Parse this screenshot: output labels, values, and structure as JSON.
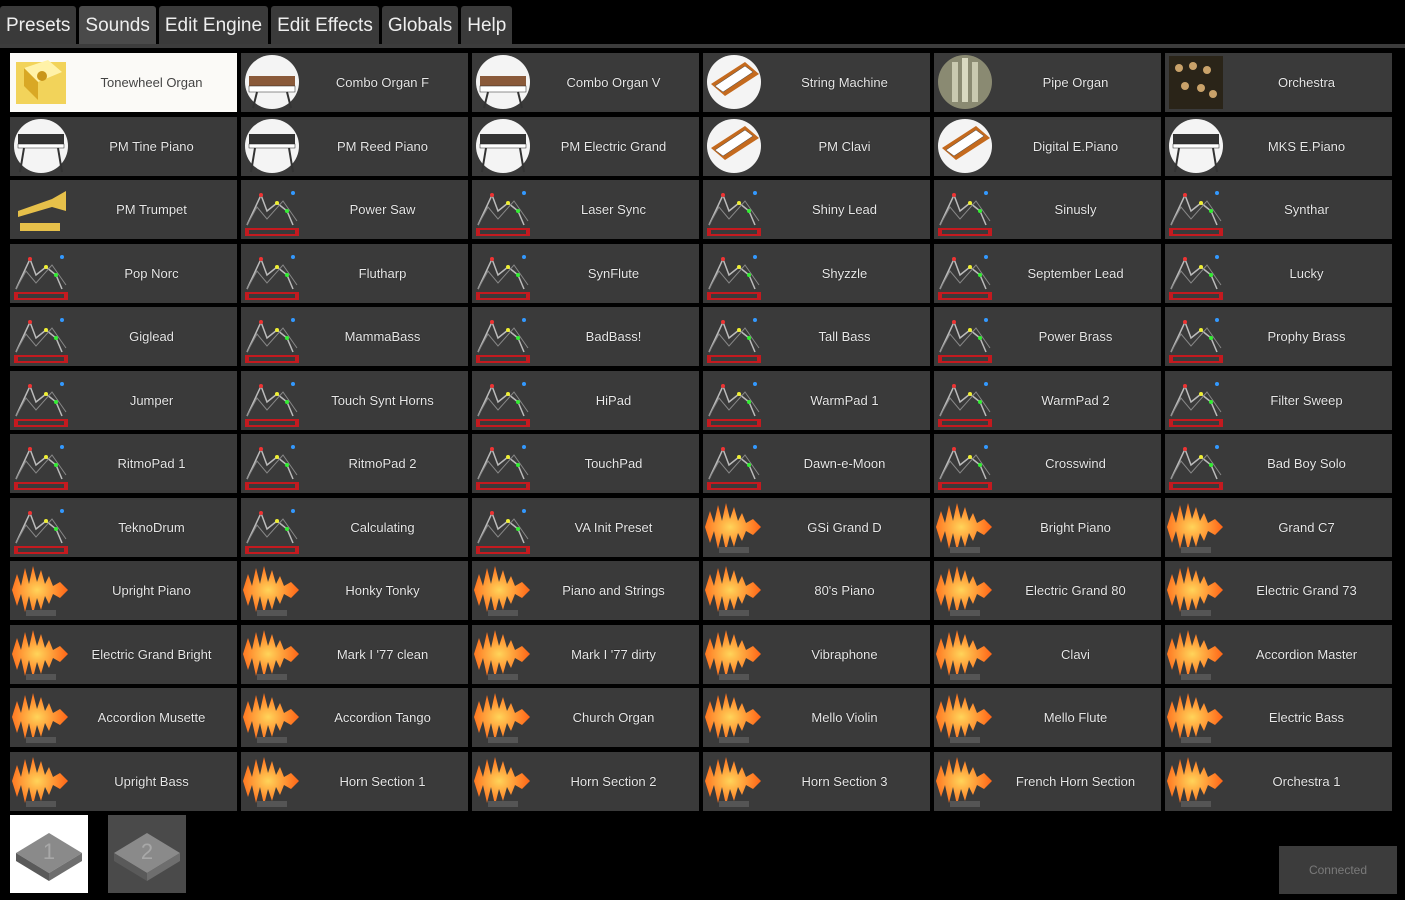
{
  "tabs": [
    {
      "label": "Presets"
    },
    {
      "label": "Sounds"
    },
    {
      "label": "Edit Engine"
    },
    {
      "label": "Edit Effects"
    },
    {
      "label": "Globals"
    },
    {
      "label": "Help"
    }
  ],
  "active_tab": 1,
  "colors": {
    "cell_bg": "#3a3a3a",
    "selected_bg": "#fbfaf7",
    "tab_bg": "#3a3a3a",
    "background": "#000000",
    "sample_icon": "#ff7a1a",
    "synth_icon_text": "#e21e24"
  },
  "sounds": [
    {
      "name": "Tonewheel Organ",
      "icon": "tonewheel-icon",
      "selected": true
    },
    {
      "name": "Combo Organ F",
      "icon": "organ-icon"
    },
    {
      "name": "Combo Organ V",
      "icon": "organ-icon"
    },
    {
      "name": "String Machine",
      "icon": "keyboard-icon"
    },
    {
      "name": "Pipe Organ",
      "icon": "pipe-organ-icon"
    },
    {
      "name": "Orchestra",
      "icon": "orchestra-icon"
    },
    {
      "name": "PM Tine Piano",
      "icon": "keyboard-stand-icon"
    },
    {
      "name": "PM Reed Piano",
      "icon": "keyboard-stand-icon"
    },
    {
      "name": "PM Electric Grand",
      "icon": "keyboard-stand-icon"
    },
    {
      "name": "PM Clavi",
      "icon": "keyboard-icon"
    },
    {
      "name": "Digital E.Piano",
      "icon": "keyboard-icon"
    },
    {
      "name": "MKS E.Piano",
      "icon": "keyboard-stand-icon"
    },
    {
      "name": "PM Trumpet",
      "icon": "trumpet-icon"
    },
    {
      "name": "Power Saw",
      "icon": "synth-envelope-icon"
    },
    {
      "name": "Laser Sync",
      "icon": "synth-envelope-icon"
    },
    {
      "name": "Shiny Lead",
      "icon": "synth-envelope-icon"
    },
    {
      "name": "Sinusly",
      "icon": "synth-envelope-icon"
    },
    {
      "name": "Synthar",
      "icon": "synth-envelope-icon"
    },
    {
      "name": "Pop Norc",
      "icon": "synth-envelope-icon"
    },
    {
      "name": "Flutharp",
      "icon": "synth-envelope-icon"
    },
    {
      "name": "SynFlute",
      "icon": "synth-envelope-icon"
    },
    {
      "name": "Shyzzle",
      "icon": "synth-envelope-icon"
    },
    {
      "name": "September Lead",
      "icon": "synth-envelope-icon"
    },
    {
      "name": "Lucky",
      "icon": "synth-envelope-icon"
    },
    {
      "name": "Giglead",
      "icon": "synth-envelope-icon"
    },
    {
      "name": "MammaBass",
      "icon": "synth-envelope-icon"
    },
    {
      "name": "BadBass!",
      "icon": "synth-envelope-icon"
    },
    {
      "name": "Tall Bass",
      "icon": "synth-envelope-icon"
    },
    {
      "name": "Power Brass",
      "icon": "synth-envelope-icon"
    },
    {
      "name": "Prophy Brass",
      "icon": "synth-envelope-icon"
    },
    {
      "name": "Jumper",
      "icon": "synth-envelope-icon"
    },
    {
      "name": "Touch Synt Horns",
      "icon": "synth-envelope-icon"
    },
    {
      "name": "HiPad",
      "icon": "synth-envelope-icon"
    },
    {
      "name": "WarmPad 1",
      "icon": "synth-envelope-icon"
    },
    {
      "name": "WarmPad 2",
      "icon": "synth-envelope-icon"
    },
    {
      "name": "Filter Sweep",
      "icon": "synth-envelope-icon"
    },
    {
      "name": "RitmoPad 1",
      "icon": "synth-envelope-icon"
    },
    {
      "name": "RitmoPad 2",
      "icon": "synth-envelope-icon"
    },
    {
      "name": "TouchPad",
      "icon": "synth-envelope-icon"
    },
    {
      "name": "Dawn-e-Moon",
      "icon": "synth-envelope-icon"
    },
    {
      "name": "Crosswind",
      "icon": "synth-envelope-icon"
    },
    {
      "name": "Bad Boy Solo",
      "icon": "synth-envelope-icon"
    },
    {
      "name": "TeknoDrum",
      "icon": "synth-envelope-icon"
    },
    {
      "name": "Calculating",
      "icon": "synth-envelope-icon"
    },
    {
      "name": "VA Init Preset",
      "icon": "synth-envelope-icon"
    },
    {
      "name": "GSi Grand D",
      "icon": "sample-waveform-icon"
    },
    {
      "name": "Bright Piano",
      "icon": "sample-waveform-icon"
    },
    {
      "name": "Grand C7",
      "icon": "sample-waveform-icon"
    },
    {
      "name": "Upright Piano",
      "icon": "sample-waveform-icon"
    },
    {
      "name": "Honky Tonky",
      "icon": "sample-waveform-icon"
    },
    {
      "name": "Piano and Strings",
      "icon": "sample-waveform-icon"
    },
    {
      "name": "80's Piano",
      "icon": "sample-waveform-icon"
    },
    {
      "name": "Electric Grand 80",
      "icon": "sample-waveform-icon"
    },
    {
      "name": "Electric Grand 73",
      "icon": "sample-waveform-icon"
    },
    {
      "name": "Electric Grand Bright",
      "icon": "sample-waveform-icon"
    },
    {
      "name": "Mark I '77 clean",
      "icon": "sample-waveform-icon"
    },
    {
      "name": "Mark I '77 dirty",
      "icon": "sample-waveform-icon"
    },
    {
      "name": "Vibraphone",
      "icon": "sample-waveform-icon"
    },
    {
      "name": "Clavi",
      "icon": "sample-waveform-icon"
    },
    {
      "name": "Accordion Master",
      "icon": "sample-waveform-icon"
    },
    {
      "name": "Accordion Musette",
      "icon": "sample-waveform-icon"
    },
    {
      "name": "Accordion Tango",
      "icon": "sample-waveform-icon"
    },
    {
      "name": "Church Organ",
      "icon": "sample-waveform-icon"
    },
    {
      "name": "Mello Violin",
      "icon": "sample-waveform-icon"
    },
    {
      "name": "Mello Flute",
      "icon": "sample-waveform-icon"
    },
    {
      "name": "Electric Bass",
      "icon": "sample-waveform-icon"
    },
    {
      "name": "Upright Bass",
      "icon": "sample-waveform-icon"
    },
    {
      "name": "Horn Section 1",
      "icon": "sample-waveform-icon"
    },
    {
      "name": "Horn Section 2",
      "icon": "sample-waveform-icon"
    },
    {
      "name": "Horn Section 3",
      "icon": "sample-waveform-icon"
    },
    {
      "name": "French Horn Section",
      "icon": "sample-waveform-icon"
    },
    {
      "name": "Orchestra 1",
      "icon": "sample-waveform-icon"
    }
  ],
  "banks": [
    {
      "label": "1",
      "selected": true
    },
    {
      "label": "2",
      "selected": false
    }
  ],
  "status_button": {
    "label": "Connected"
  }
}
